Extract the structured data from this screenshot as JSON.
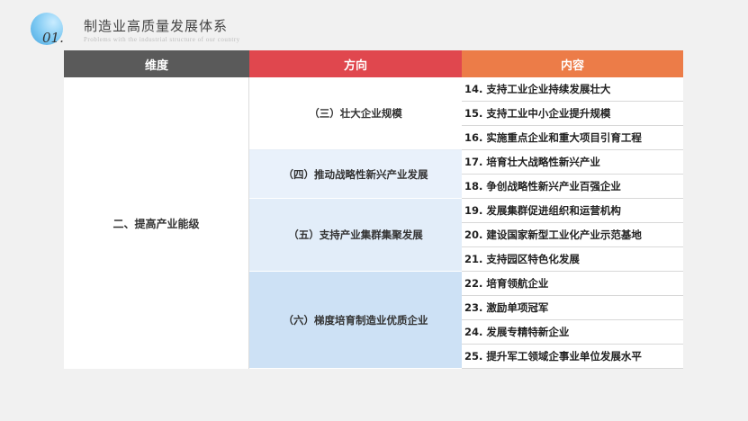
{
  "header": {
    "number": "01.",
    "title": "制造业高质量发展体系",
    "subtitle": "Problems with the industrial structure of our country"
  },
  "table": {
    "columns": [
      "维度",
      "方向",
      "内容"
    ],
    "dimension": "二、提高产业能级",
    "directions": [
      {
        "label": "（三）壮大企业规模"
      },
      {
        "label": "（四）推动战略性新兴产业发展"
      },
      {
        "label": "（五）支持产业集群集聚发展"
      },
      {
        "label": "（六）梯度培育制造业优质企业"
      }
    ],
    "contents": [
      "14. 支持工业企业持续发展壮大",
      "15. 支持工业中小企业提升规模",
      "16. 实施重点企业和重大项目引育工程",
      "17. 培育壮大战略性新兴产业",
      "18. 争创战略性新兴产业百强企业",
      "19. 发展集群促进组织和运营机构",
      "20. 建设国家新型工业化产业示范基地",
      "21. 支持园区特色化发展",
      "22. 培育领航企业",
      "23. 激励单项冠军",
      "24. 发展专精特新企业",
      "25. 提升军工领域企事业单位发展水平"
    ]
  },
  "colors": {
    "header_dimension": "#5a5a5a",
    "header_direction": "#e0474e",
    "header_content": "#ec7c48",
    "accent_blue": "#4aa7e0"
  }
}
